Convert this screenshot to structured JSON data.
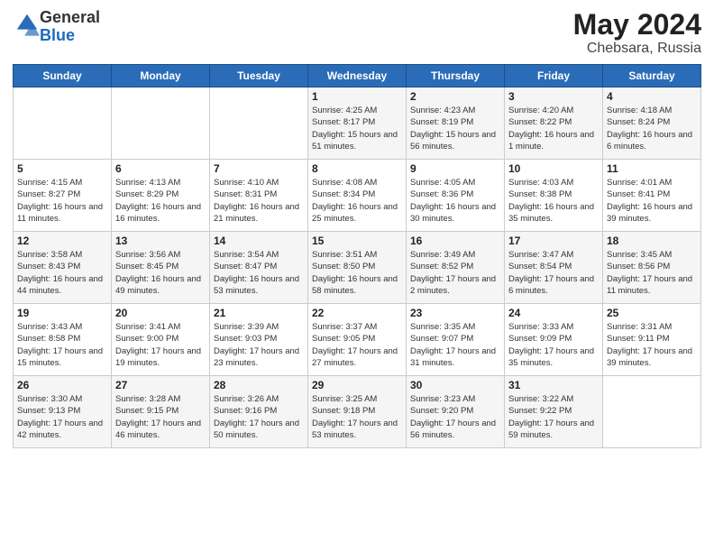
{
  "header": {
    "logo": {
      "general": "General",
      "blue": "Blue"
    },
    "title": "May 2024",
    "location": "Chebsara, Russia"
  },
  "weekdays": [
    "Sunday",
    "Monday",
    "Tuesday",
    "Wednesday",
    "Thursday",
    "Friday",
    "Saturday"
  ],
  "weeks": [
    [
      null,
      null,
      null,
      {
        "day": "1",
        "sunrise": "Sunrise: 4:25 AM",
        "sunset": "Sunset: 8:17 PM",
        "daylight": "Daylight: 15 hours and 51 minutes."
      },
      {
        "day": "2",
        "sunrise": "Sunrise: 4:23 AM",
        "sunset": "Sunset: 8:19 PM",
        "daylight": "Daylight: 15 hours and 56 minutes."
      },
      {
        "day": "3",
        "sunrise": "Sunrise: 4:20 AM",
        "sunset": "Sunset: 8:22 PM",
        "daylight": "Daylight: 16 hours and 1 minute."
      },
      {
        "day": "4",
        "sunrise": "Sunrise: 4:18 AM",
        "sunset": "Sunset: 8:24 PM",
        "daylight": "Daylight: 16 hours and 6 minutes."
      }
    ],
    [
      {
        "day": "5",
        "sunrise": "Sunrise: 4:15 AM",
        "sunset": "Sunset: 8:27 PM",
        "daylight": "Daylight: 16 hours and 11 minutes."
      },
      {
        "day": "6",
        "sunrise": "Sunrise: 4:13 AM",
        "sunset": "Sunset: 8:29 PM",
        "daylight": "Daylight: 16 hours and 16 minutes."
      },
      {
        "day": "7",
        "sunrise": "Sunrise: 4:10 AM",
        "sunset": "Sunset: 8:31 PM",
        "daylight": "Daylight: 16 hours and 21 minutes."
      },
      {
        "day": "8",
        "sunrise": "Sunrise: 4:08 AM",
        "sunset": "Sunset: 8:34 PM",
        "daylight": "Daylight: 16 hours and 25 minutes."
      },
      {
        "day": "9",
        "sunrise": "Sunrise: 4:05 AM",
        "sunset": "Sunset: 8:36 PM",
        "daylight": "Daylight: 16 hours and 30 minutes."
      },
      {
        "day": "10",
        "sunrise": "Sunrise: 4:03 AM",
        "sunset": "Sunset: 8:38 PM",
        "daylight": "Daylight: 16 hours and 35 minutes."
      },
      {
        "day": "11",
        "sunrise": "Sunrise: 4:01 AM",
        "sunset": "Sunset: 8:41 PM",
        "daylight": "Daylight: 16 hours and 39 minutes."
      }
    ],
    [
      {
        "day": "12",
        "sunrise": "Sunrise: 3:58 AM",
        "sunset": "Sunset: 8:43 PM",
        "daylight": "Daylight: 16 hours and 44 minutes."
      },
      {
        "day": "13",
        "sunrise": "Sunrise: 3:56 AM",
        "sunset": "Sunset: 8:45 PM",
        "daylight": "Daylight: 16 hours and 49 minutes."
      },
      {
        "day": "14",
        "sunrise": "Sunrise: 3:54 AM",
        "sunset": "Sunset: 8:47 PM",
        "daylight": "Daylight: 16 hours and 53 minutes."
      },
      {
        "day": "15",
        "sunrise": "Sunrise: 3:51 AM",
        "sunset": "Sunset: 8:50 PM",
        "daylight": "Daylight: 16 hours and 58 minutes."
      },
      {
        "day": "16",
        "sunrise": "Sunrise: 3:49 AM",
        "sunset": "Sunset: 8:52 PM",
        "daylight": "Daylight: 17 hours and 2 minutes."
      },
      {
        "day": "17",
        "sunrise": "Sunrise: 3:47 AM",
        "sunset": "Sunset: 8:54 PM",
        "daylight": "Daylight: 17 hours and 6 minutes."
      },
      {
        "day": "18",
        "sunrise": "Sunrise: 3:45 AM",
        "sunset": "Sunset: 8:56 PM",
        "daylight": "Daylight: 17 hours and 11 minutes."
      }
    ],
    [
      {
        "day": "19",
        "sunrise": "Sunrise: 3:43 AM",
        "sunset": "Sunset: 8:58 PM",
        "daylight": "Daylight: 17 hours and 15 minutes."
      },
      {
        "day": "20",
        "sunrise": "Sunrise: 3:41 AM",
        "sunset": "Sunset: 9:00 PM",
        "daylight": "Daylight: 17 hours and 19 minutes."
      },
      {
        "day": "21",
        "sunrise": "Sunrise: 3:39 AM",
        "sunset": "Sunset: 9:03 PM",
        "daylight": "Daylight: 17 hours and 23 minutes."
      },
      {
        "day": "22",
        "sunrise": "Sunrise: 3:37 AM",
        "sunset": "Sunset: 9:05 PM",
        "daylight": "Daylight: 17 hours and 27 minutes."
      },
      {
        "day": "23",
        "sunrise": "Sunrise: 3:35 AM",
        "sunset": "Sunset: 9:07 PM",
        "daylight": "Daylight: 17 hours and 31 minutes."
      },
      {
        "day": "24",
        "sunrise": "Sunrise: 3:33 AM",
        "sunset": "Sunset: 9:09 PM",
        "daylight": "Daylight: 17 hours and 35 minutes."
      },
      {
        "day": "25",
        "sunrise": "Sunrise: 3:31 AM",
        "sunset": "Sunset: 9:11 PM",
        "daylight": "Daylight: 17 hours and 39 minutes."
      }
    ],
    [
      {
        "day": "26",
        "sunrise": "Sunrise: 3:30 AM",
        "sunset": "Sunset: 9:13 PM",
        "daylight": "Daylight: 17 hours and 42 minutes."
      },
      {
        "day": "27",
        "sunrise": "Sunrise: 3:28 AM",
        "sunset": "Sunset: 9:15 PM",
        "daylight": "Daylight: 17 hours and 46 minutes."
      },
      {
        "day": "28",
        "sunrise": "Sunrise: 3:26 AM",
        "sunset": "Sunset: 9:16 PM",
        "daylight": "Daylight: 17 hours and 50 minutes."
      },
      {
        "day": "29",
        "sunrise": "Sunrise: 3:25 AM",
        "sunset": "Sunset: 9:18 PM",
        "daylight": "Daylight: 17 hours and 53 minutes."
      },
      {
        "day": "30",
        "sunrise": "Sunrise: 3:23 AM",
        "sunset": "Sunset: 9:20 PM",
        "daylight": "Daylight: 17 hours and 56 minutes."
      },
      {
        "day": "31",
        "sunrise": "Sunrise: 3:22 AM",
        "sunset": "Sunset: 9:22 PM",
        "daylight": "Daylight: 17 hours and 59 minutes."
      },
      null
    ]
  ]
}
